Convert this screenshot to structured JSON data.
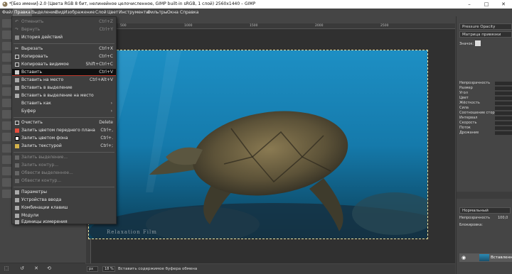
{
  "window": {
    "title": "*[Без имени]-2.0 (Цвета RGB 8 бит, нелинейное целочисленное, GIMP built-in sRGB, 1 слой) 2560x1440 – GIMP",
    "minimize": "–",
    "maximize": "□",
    "close": "✕"
  },
  "menubar": [
    "Файл",
    "Правка",
    "Выделение",
    "Вид",
    "Изображение",
    "Слой",
    "Цвет",
    "Инструменты",
    "Фильтры",
    "Окна",
    "Справка"
  ],
  "edit_menu": {
    "items": [
      {
        "label": "Отменить",
        "shortcut": "Ctrl+Z",
        "disabled": true
      },
      {
        "label": "Вернуть",
        "shortcut": "Ctrl+Y",
        "disabled": true
      },
      {
        "label": "История действий",
        "shortcut": "",
        "disabled": false
      },
      {
        "label": "Вырезать",
        "shortcut": "Ctrl+X",
        "disabled": false
      },
      {
        "label": "Копировать",
        "shortcut": "Ctrl+C",
        "disabled": false
      },
      {
        "label": "Копировать видимое",
        "shortcut": "Shift+Ctrl+C",
        "disabled": false
      },
      {
        "label": "Вставить",
        "shortcut": "Ctrl+V",
        "disabled": false
      },
      {
        "label": "Вставить на место",
        "shortcut": "Ctrl+Alt+V",
        "disabled": false
      },
      {
        "label": "Вставить в выделение",
        "shortcut": "",
        "disabled": false
      },
      {
        "label": "Вставить в выделение на место",
        "shortcut": "",
        "disabled": false
      },
      {
        "label": "Вставить как",
        "shortcut": "",
        "disabled": false
      },
      {
        "label": "Буфер",
        "shortcut": "",
        "disabled": false
      },
      {
        "label": "Очистить",
        "shortcut": "Delete",
        "disabled": false
      },
      {
        "label": "Залить цветом переднего плана",
        "shortcut": "Ctrl+,",
        "disabled": false
      },
      {
        "label": "Залить цветом фона",
        "shortcut": "Ctrl+.",
        "disabled": false
      },
      {
        "label": "Залить текстурой",
        "shortcut": "Ctrl+;",
        "disabled": false
      },
      {
        "label": "Залить выделение...",
        "shortcut": "",
        "disabled": true
      },
      {
        "label": "Залить контур...",
        "shortcut": "",
        "disabled": true
      },
      {
        "label": "Обвести выделенное...",
        "shortcut": "",
        "disabled": true
      },
      {
        "label": "Обвести контур...",
        "shortcut": "",
        "disabled": true
      },
      {
        "label": "Параметры",
        "shortcut": "",
        "disabled": false
      },
      {
        "label": "Устройства ввода",
        "shortcut": "",
        "disabled": false
      },
      {
        "label": "Комбинации клавиш",
        "shortcut": "",
        "disabled": false
      },
      {
        "label": "Модули",
        "shortcut": "",
        "disabled": false
      },
      {
        "label": "Единицы измерения",
        "shortcut": "",
        "disabled": false
      }
    ]
  },
  "rulers": {
    "horizontal": [
      "500",
      "1000",
      "1500",
      "2000",
      "2500"
    ]
  },
  "image": {
    "watermark": "Relaxation Film"
  },
  "statusbar": {
    "unit": "px",
    "zoom": "18 %",
    "message": "Вставить содержимое буфера обмена"
  },
  "dock": {
    "dynamics_title": "Pressure Opacity",
    "grid_option": "Матрица привязки",
    "snap_label": "Значок:",
    "options": [
      "Непрозрачность",
      "Размер",
      "Угол",
      "Цвет",
      "Жёсткость",
      "Сила",
      "Соотношение сторо",
      "Интервал",
      "Скорость",
      "Поток",
      "Дрожание"
    ],
    "mode": "Нормальный",
    "opacity_label": "Непрозрачность",
    "opacity_value": "100,0",
    "lock_label": "Блокировка:",
    "layer_name": "Вставленный"
  },
  "colors": {
    "accent_red": "#c0392b",
    "selection_outline": "#e8e0a0",
    "fg_swatch": "#e74c3c"
  }
}
